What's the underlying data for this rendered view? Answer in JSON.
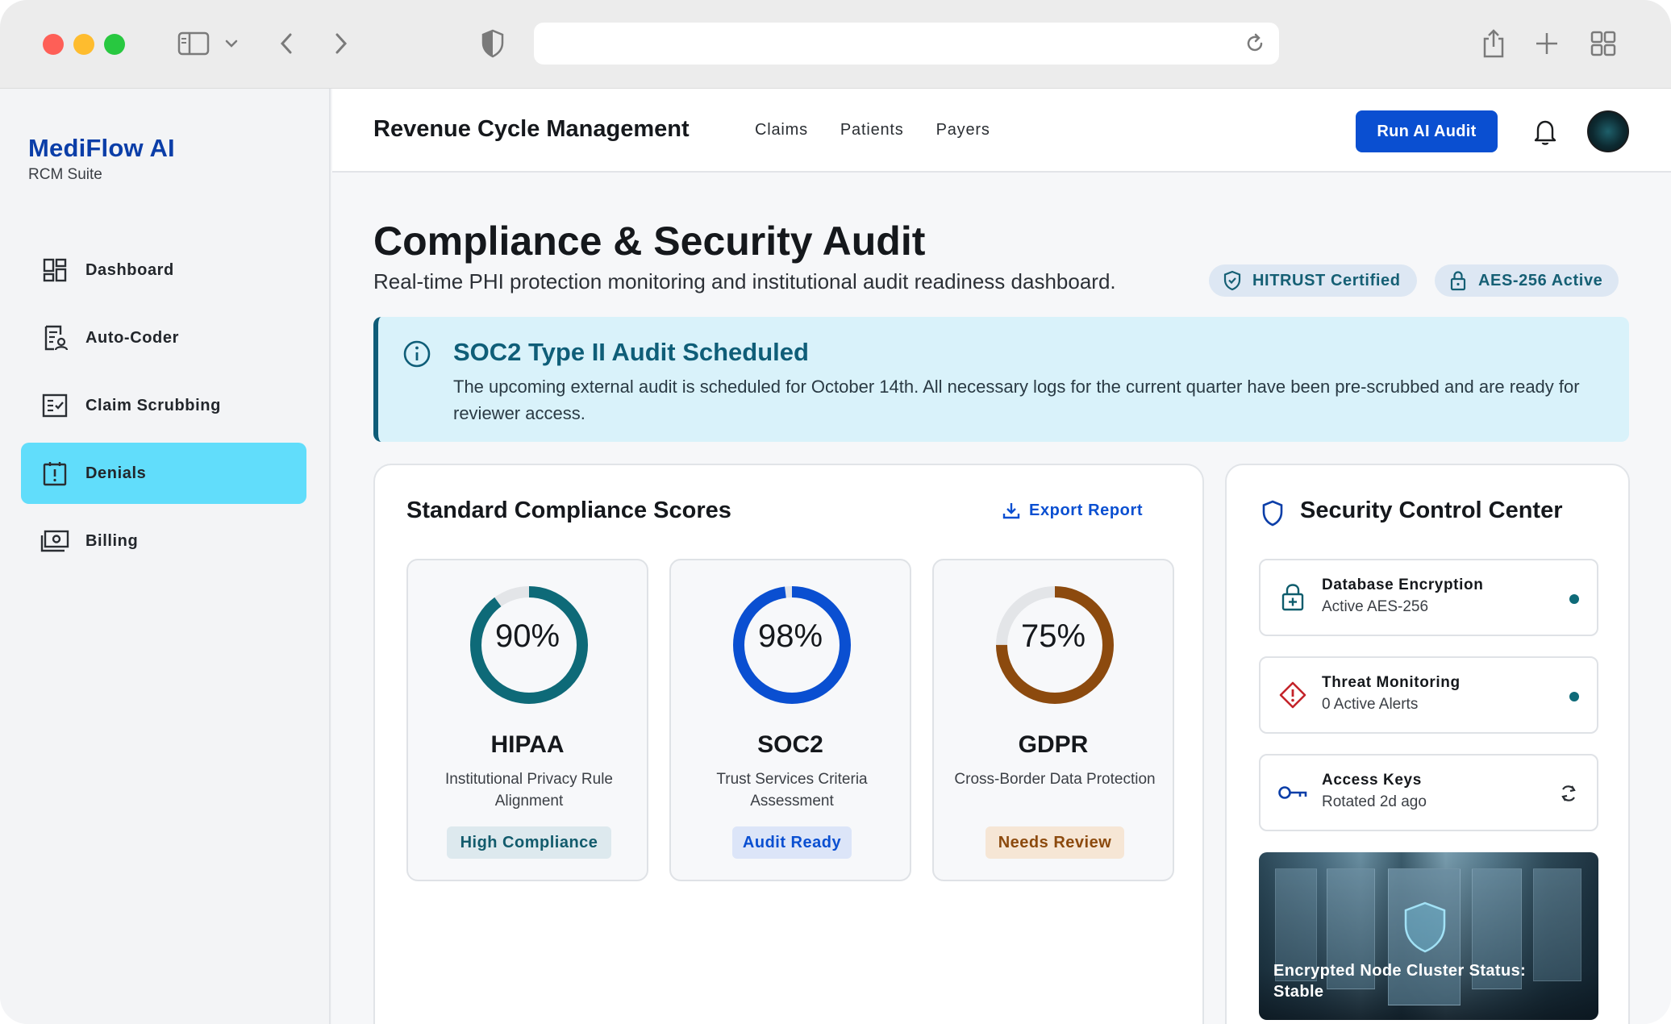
{
  "browser": {
    "url": ""
  },
  "sidebar": {
    "brand": "MediFlow AI",
    "brand_sub": "RCM Suite",
    "items": [
      {
        "label": "Dashboard",
        "icon": "dashboard-grid-icon"
      },
      {
        "label": "Auto-Coder",
        "icon": "auto-coder-icon"
      },
      {
        "label": "Claim Scrubbing",
        "icon": "checklist-icon"
      },
      {
        "label": "Denials",
        "icon": "alert-square-icon",
        "active": true
      },
      {
        "label": "Billing",
        "icon": "billing-cash-icon"
      }
    ]
  },
  "topbar": {
    "title": "Revenue Cycle Management",
    "nav": [
      "Claims",
      "Patients",
      "Payers"
    ],
    "run_audit_label": "Run AI Audit"
  },
  "page": {
    "title": "Compliance & Security Audit",
    "subtitle": "Real-time PHI protection monitoring and institutional audit readiness dashboard.",
    "badges": {
      "hitrust": "HITRUST Certified",
      "aes": "AES-256 Active"
    }
  },
  "alert": {
    "title": "SOC2 Type II Audit Scheduled",
    "body": "The upcoming external audit is scheduled for October 14th. All necessary logs for the current quarter have been pre-scrubbed and are ready for reviewer access."
  },
  "compliance": {
    "title": "Standard Compliance Scores",
    "export_label": "Export Report",
    "scores": [
      {
        "value": 90,
        "pct": "90%",
        "name": "HIPAA",
        "desc": "Institutional Privacy Rule Alignment",
        "tag": "High Compliance",
        "color": "#0e6a78"
      },
      {
        "value": 98,
        "pct": "98%",
        "name": "SOC2",
        "desc": "Trust Services Criteria Assessment",
        "tag": "Audit Ready",
        "color": "#0a4fd1"
      },
      {
        "value": 75,
        "pct": "75%",
        "name": "GDPR",
        "desc": "Cross-Border Data Protection",
        "tag": "Needs Review",
        "color": "#8c4a0e"
      }
    ]
  },
  "security": {
    "title": "Security Control Center",
    "items": [
      {
        "name": "Database Encryption",
        "status": "Active AES-256",
        "icon": "lock-plus-icon"
      },
      {
        "name": "Threat Monitoring",
        "status": "0 Active Alerts",
        "icon": "warning-diamond-icon"
      },
      {
        "name": "Access Keys",
        "status": "Rotated 2d ago",
        "icon": "key-icon"
      }
    ],
    "image_caption": "Encrypted Node Cluster Status: Stable"
  },
  "colors": {
    "brand": "#0b3ea8",
    "primary": "#0a4fd1",
    "active_nav": "#61ddfb",
    "teal": "#0e6a78"
  }
}
